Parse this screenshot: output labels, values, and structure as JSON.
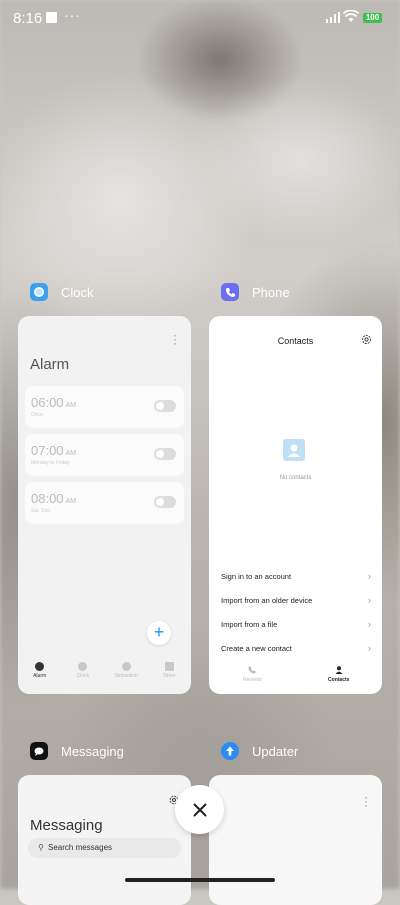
{
  "status": {
    "time": "8:16",
    "more": "···",
    "battery": "100"
  },
  "apps": {
    "clock": {
      "name": "Clock",
      "title": "Alarm",
      "alarms": [
        {
          "time": "06:00",
          "ampm": "AM",
          "sub": "Once",
          "enabled": false
        },
        {
          "time": "07:00",
          "ampm": "AM",
          "sub": "Monday to Friday",
          "enabled": false
        },
        {
          "time": "08:00",
          "ampm": "AM",
          "sub": "Sat, Sun",
          "enabled": false
        }
      ],
      "tabs": [
        "Alarm",
        "Clock",
        "Stopwatch",
        "Timer"
      ]
    },
    "phone": {
      "name": "Phone",
      "title": "Contacts",
      "empty_text": "No contacts",
      "options": [
        "Sign in to an account",
        "Import from an older device",
        "Import from a file",
        "Create a new contact"
      ],
      "tabs": [
        "Recents",
        "Contacts"
      ]
    },
    "messaging": {
      "name": "Messaging",
      "title": "Messaging",
      "search_placeholder": "Search messages"
    },
    "updater": {
      "name": "Updater"
    }
  },
  "colors": {
    "clock_icon": "#3d9ff0",
    "phone_icon": "#6a6ff0",
    "updater_icon": "#2d8cf0",
    "fab": "#2f8ff0",
    "battery": "#3fbf4f"
  },
  "icons": [
    "clock-app-icon",
    "phone-app-icon",
    "messaging-app-icon",
    "updater-app-icon",
    "gear-icon",
    "close-icon",
    "plus-icon",
    "chevron-right-icon",
    "search-icon"
  ]
}
